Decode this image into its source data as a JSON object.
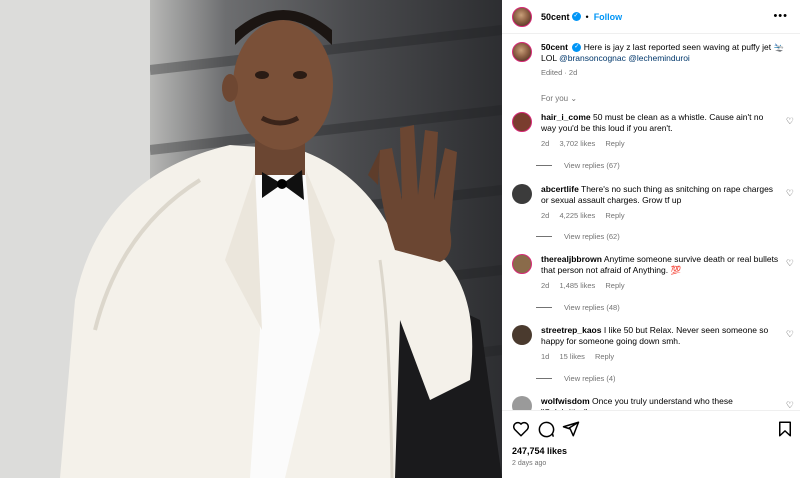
{
  "post": {
    "username": "50cent",
    "follow_label": "Follow",
    "caption_text": "Here is jay z last reported seen waving at puffy jet 🛬 LOL ",
    "caption_mention_1": "@bransoncognac",
    "caption_mention_2": "@lecheminduroi",
    "caption_meta": "Edited · 2d",
    "for_you": "For you ⌄",
    "likes": "247,754 likes",
    "posted_ago": "2 days ago"
  },
  "comments": [
    {
      "user": "hair_i_come",
      "text": "50 must be clean as a whistle. Cause ain't no way you'd be this loud if you aren't.",
      "time": "2d",
      "likes": "3,702 likes",
      "reply": "Reply",
      "view_replies": "View replies (67)",
      "avatar_color": "#7a3d2e"
    },
    {
      "user": "abcertlife",
      "text": "There's no such thing as snitching on rape charges or sexual assault charges. Grow tf up",
      "time": "2d",
      "likes": "4,225 likes",
      "reply": "Reply",
      "view_replies": "View replies (62)",
      "avatar_color": "#3b3b3b"
    },
    {
      "user": "therealjbbrown",
      "text": "Anytime someone survive death or real bullets that person not afraid of Anything. 💯",
      "time": "2d",
      "likes": "1,485 likes",
      "reply": "Reply",
      "view_replies": "View replies (48)",
      "avatar_color": "#8a6b4a"
    },
    {
      "user": "streetrep_kaos",
      "text": "I like 50 but Relax. Never seen someone so happy for someone going down smh.",
      "time": "1d",
      "likes": "15 likes",
      "reply": "Reply",
      "view_replies": "View replies (4)",
      "avatar_color": "#4a3a2e"
    },
    {
      "user": "wolfwisdom",
      "text": "Once you truly understand who these \"Celebrities\"",
      "time": "",
      "likes": "",
      "reply": "",
      "view_replies": "",
      "avatar_color": "#9a9a9a"
    }
  ],
  "icons": {
    "more": "more-options-icon",
    "heart": "heart-icon",
    "comment": "comment-icon",
    "share": "share-icon",
    "save": "bookmark-icon"
  },
  "colors": {
    "accent": "#0095f6",
    "muted": "#737373"
  }
}
